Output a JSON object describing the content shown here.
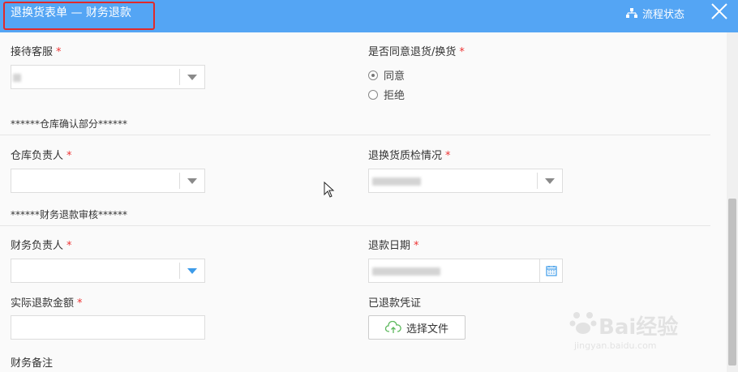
{
  "header": {
    "title": "退换货表单 — 财务退款",
    "flow_status_label": "流程状态",
    "accent": "#54a5f4"
  },
  "form": {
    "reception_label": "接待客服",
    "agree_label": "是否同意退货/换货",
    "agree_options": [
      {
        "label": "同意",
        "selected": true
      },
      {
        "label": "拒绝",
        "selected": false
      }
    ],
    "section_warehouse": "******仓库确认部分******",
    "warehouse_manager_label": "仓库负责人",
    "quality_label": "退换货质检情况",
    "section_finance": "******财务退款审核******",
    "finance_manager_label": "财务负责人",
    "refund_date_label": "退款日期",
    "actual_amount_label": "实际退款金额",
    "refund_proof_label": "已退款凭证",
    "upload_label": "选择文件",
    "finance_note_label": "财务备注",
    "required_mark": "*"
  },
  "watermark": {
    "brand": "Bai经验",
    "url": "jingyan.baidu.com"
  }
}
